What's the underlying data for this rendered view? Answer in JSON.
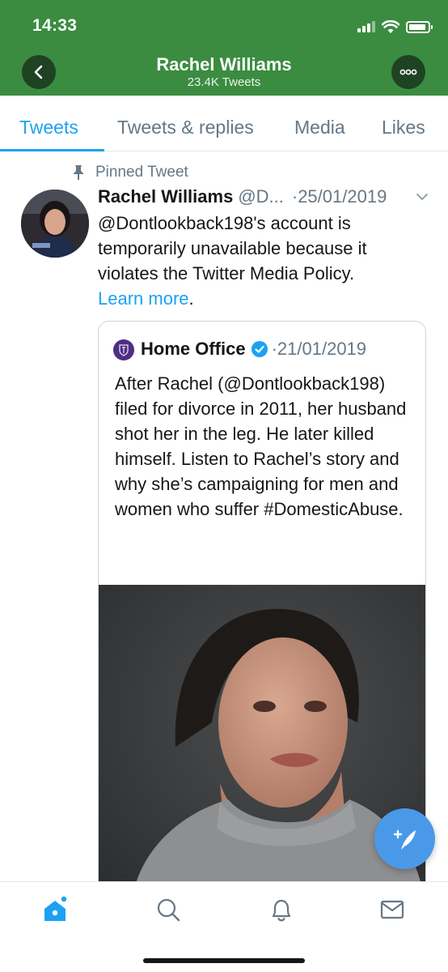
{
  "status_bar": {
    "time": "14:33"
  },
  "header": {
    "title": "Rachel Williams",
    "subtitle": "23.4K Tweets",
    "back_icon": "chevron-left-icon",
    "more_label": "ooo",
    "bg_color": "#3b8c41"
  },
  "tabs": [
    {
      "label": "Tweets",
      "active": true
    },
    {
      "label": "Tweets & replies",
      "active": false
    },
    {
      "label": "Media",
      "active": false
    },
    {
      "label": "Likes",
      "active": false
    }
  ],
  "pinned_tweet": {
    "pinned_label": "Pinned Tweet",
    "author_name": "Rachel Williams",
    "author_handle": "@D...",
    "date": "·25/01/2019",
    "body_text": "@Dontlookback198's account is temporarily unavailable because it violates the Twitter Media Policy.",
    "link_text": "Learn more",
    "link_suffix": ".",
    "quoted": {
      "author_name": "Home Office",
      "date": "·21/01/2019",
      "body_text": "After Rachel (@Dontlookback198) filed for divorce in 2011, her husband shot her in the leg. He later killed himself. Listen to Rachel’s story and why she’s campaigning for men and women who suffer #DomesticAbuse."
    }
  },
  "bottom_nav": [
    {
      "name": "home-icon",
      "active": true
    },
    {
      "name": "search-icon",
      "active": false
    },
    {
      "name": "notifications-icon",
      "active": false
    },
    {
      "name": "messages-icon",
      "active": false
    }
  ],
  "colors": {
    "accent": "#1da1f2",
    "muted": "#657786",
    "text": "#14171a",
    "fab": "#4a99e9"
  }
}
